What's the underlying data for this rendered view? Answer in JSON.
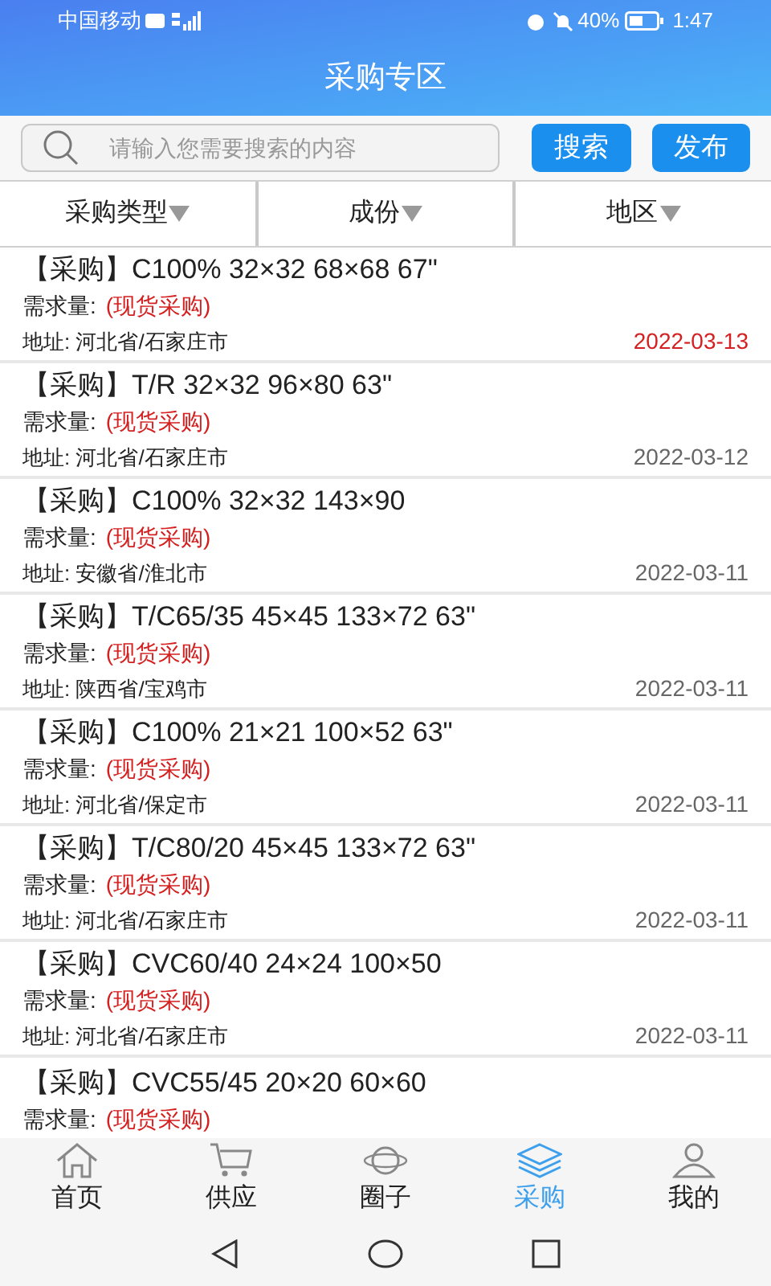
{
  "status_bar": {
    "carrier": "中国移动",
    "battery": "40%",
    "time": "1:47"
  },
  "header": {
    "title": "采购专区"
  },
  "search": {
    "placeholder": "请输入您需要搜索的内容",
    "buttons": [
      "搜索",
      "发布"
    ]
  },
  "filters": [
    {
      "label": "采购类型"
    },
    {
      "label": "成份"
    },
    {
      "label": "地区"
    }
  ],
  "listings": [
    {
      "tag": "【采购】",
      "title": "C100% 32×32 68×68 67\"",
      "demand_label": "需求量:",
      "demand": "(现货采购)",
      "address": "地址: 河北省/石家庄市",
      "date": "2022-03-13",
      "highlighted": true
    },
    {
      "tag": "【采购】",
      "title": "T/R 32×32 96×80 63\"",
      "demand_label": "需求量:",
      "demand": "(现货采购)",
      "address": "地址: 河北省/石家庄市",
      "date": "2022-03-12",
      "highlighted": false
    },
    {
      "tag": "【采购】",
      "title": "C100% 32×32 143×90",
      "demand_label": "需求量:",
      "demand": "(现货采购)",
      "address": "地址: 安徽省/淮北市",
      "date": "2022-03-11",
      "highlighted": false
    },
    {
      "tag": "【采购】",
      "title": "T/C65/35 45×45 133×72 63\"",
      "demand_label": "需求量:",
      "demand": "(现货采购)",
      "address": "地址: 陕西省/宝鸡市",
      "date": "2022-03-11",
      "highlighted": false
    },
    {
      "tag": "【采购】",
      "title": "C100% 21×21 100×52 63\"",
      "demand_label": "需求量:",
      "demand": "(现货采购)",
      "address": "地址: 河北省/保定市",
      "date": "2022-03-11",
      "highlighted": false
    },
    {
      "tag": "【采购】",
      "title": "T/C80/20 45×45 133×72 63\"",
      "demand_label": "需求量:",
      "demand": "(现货采购)",
      "address": "地址: 河北省/石家庄市",
      "date": "2022-03-11",
      "highlighted": false
    },
    {
      "tag": "【采购】",
      "title": "CVC60/40 24×24 100×50",
      "demand_label": "需求量:",
      "demand": "(现货采购)",
      "address": "地址: 河北省/石家庄市",
      "date": "2022-03-11",
      "highlighted": false
    },
    {
      "tag": "【采购】",
      "title": "CVC55/45 20×20 60×60",
      "demand_label": "需求量:",
      "demand": "(现货采购)"
    }
  ],
  "tab_bar": [
    {
      "label": "首页",
      "kind": "home",
      "selected": false
    },
    {
      "label": "供应",
      "kind": "cart",
      "selected": false
    },
    {
      "label": "圈子",
      "kind": "planet",
      "selected": false
    },
    {
      "label": "采购",
      "kind": "layers",
      "selected": true
    },
    {
      "label": "我的",
      "kind": "person",
      "selected": false
    }
  ]
}
